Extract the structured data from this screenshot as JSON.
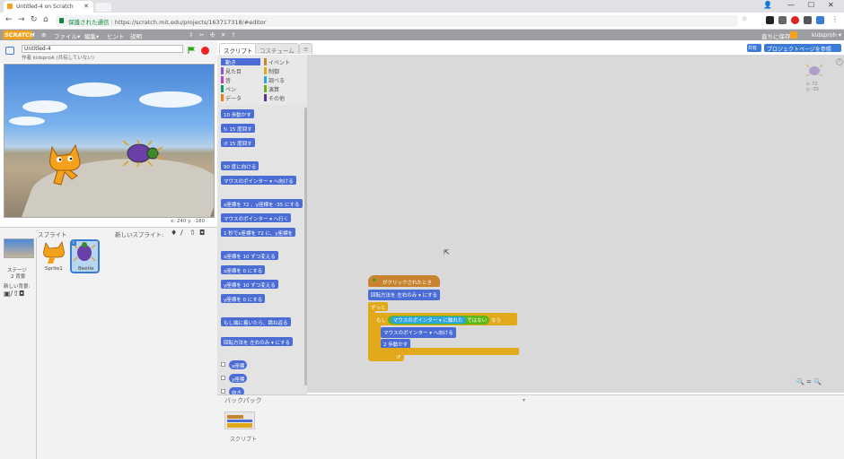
{
  "browser": {
    "tab_title": "Untitled-4 on Scratch",
    "secure_label": "保護された通信",
    "url": "https://scratch.mit.edu/projects/163717318/#editor"
  },
  "menubar": {
    "logo": "SCRATCH",
    "file": "ファイル▾",
    "edit": "編集▾",
    "hint": "ヒント",
    "about": "説明",
    "share_label": "共有",
    "user": "kidsproh ▾",
    "save_now": "直ちに保存"
  },
  "stage": {
    "project_title": "Untitled-4",
    "byline": "作者 kidsproA (共有していない)",
    "coords": "x: 240  y: -180"
  },
  "sprites": {
    "header": "スプライト",
    "new_sprite": "新しいスプライト:",
    "stage_label": "ステージ",
    "stage_bg_count": "2 背景",
    "new_bg": "新しい背景:",
    "items": [
      "Sprite1",
      "Beetle"
    ]
  },
  "tabs": {
    "scripts": "スクリプト",
    "costumes": "コスチューム",
    "sounds": "≡"
  },
  "categories": [
    {
      "label": "動き",
      "color": "#4a6cd4"
    },
    {
      "label": "見た目",
      "color": "#8a55d7"
    },
    {
      "label": "音",
      "color": "#bb42c3"
    },
    {
      "label": "ペン",
      "color": "#0e9a6c"
    },
    {
      "label": "データ",
      "color": "#ee7d16"
    },
    {
      "label": "イベント",
      "color": "#c88330"
    },
    {
      "label": "制御",
      "color": "#e1a91a"
    },
    {
      "label": "調べる",
      "color": "#2ca5e2"
    },
    {
      "label": "演算",
      "color": "#5cb712"
    },
    {
      "label": "その他",
      "color": "#632d99"
    }
  ],
  "palette_blocks": [
    "10 歩動かす",
    "↻ 15 度回す",
    "↺ 15 度回す",
    "90 度に向ける",
    "マウスのポインター ▾ へ向ける",
    "x座標を 72 、y座標を -35 にする",
    "マウスのポインター ▾ へ行く",
    "1 秒でx座標を 72 に、y座標を",
    "x座標を 10 ずつ変える",
    "x座標を 0 にする",
    "y座標を 10 ずつ変える",
    "y座標を 0 にする",
    "もし端に着いたら、跳ね返る",
    "回転方法を 左右のみ ▾ にする",
    "x座標",
    "y座標",
    "向き"
  ],
  "script": {
    "hat": "がクリックされたとき",
    "rotation": "回転方法を 左右のみ ▾ にする",
    "forever": "ずっと",
    "if_word": "もし",
    "touching": "マウスのポインター ▾ に触れた",
    "not_word": "ではない",
    "then_word": "なら",
    "point_towards": "マウスのポインター ▾ へ向ける",
    "move": "2 歩動かす"
  },
  "project_page_button": "プロジェクトページを参照",
  "share_button": "共有",
  "sprite_xy": "x: 72\ny: -35",
  "zoom": "🔍 = 🔍",
  "backpack": {
    "title": "バックパック",
    "item_label": "スクリプト"
  }
}
